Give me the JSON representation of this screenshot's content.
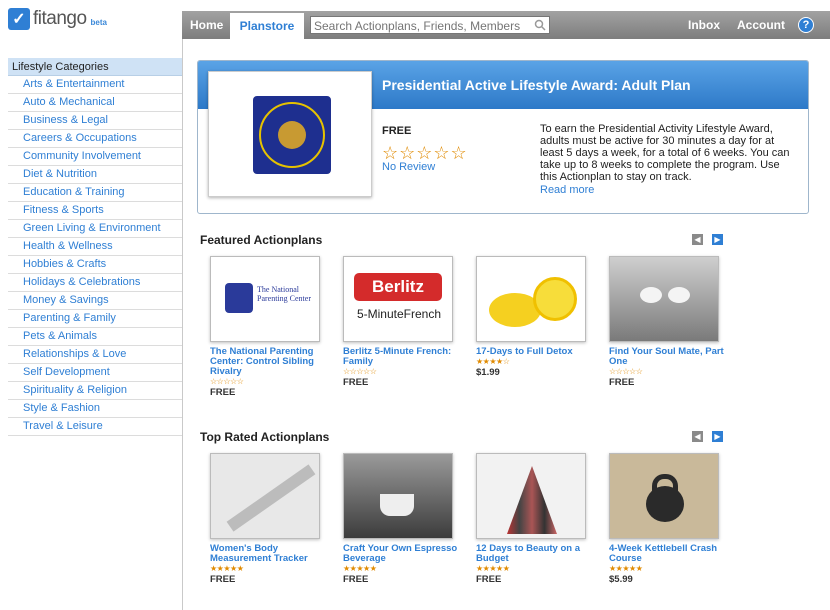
{
  "app": {
    "logo": "fitango",
    "beta": "beta"
  },
  "nav": {
    "home": "Home",
    "planstore": "Planstore",
    "search_placeholder": "Search Actionplans, Friends, Members",
    "inbox": "Inbox",
    "account": "Account",
    "help": "?"
  },
  "sidebar": {
    "header": "Lifestyle Categories",
    "items": [
      "Arts & Entertainment",
      "Auto & Mechanical",
      "Business & Legal",
      "Careers & Occupations",
      "Community Involvement",
      "Diet & Nutrition",
      "Education & Training",
      "Fitness & Sports",
      "Green Living & Environment",
      "Health & Wellness",
      "Hobbies & Crafts",
      "Holidays & Celebrations",
      "Money & Savings",
      "Parenting & Family",
      "Pets & Animals",
      "Relationships & Love",
      "Self Development",
      "Spirituality & Religion",
      "Style & Fashion",
      "Travel & Leisure"
    ]
  },
  "hero": {
    "title": "Presidential Active Lifestyle Award: Adult Plan",
    "seal_text": "PRESIDENTIAL ACTIVE LIFESTYLE AWARD",
    "price": "FREE",
    "stars": "☆☆☆☆☆",
    "review": "No Review",
    "description": "To earn the Presidential Activity Lifestyle Award, adults must be active for 30 minutes a day for at least 5 days a week, for a total of 6 weeks. You can take up to 8 weeks to complete the program. Use this Actionplan to stay on track.",
    "read_more": "Read more"
  },
  "featured": {
    "title": "Featured Actionplans",
    "items": [
      {
        "title": "The National Parenting Center: Control Sibling Rivalry",
        "stars": "☆☆☆☆☆",
        "price": "FREE",
        "logo": "The National Parenting Center"
      },
      {
        "title": "Berlitz 5-Minute French: Family",
        "stars": "☆☆☆☆☆",
        "price": "FREE",
        "logo_top": "Berlitz",
        "logo_bottom": "5-MinuteFrench"
      },
      {
        "title": "17-Days to Full Detox",
        "stars": "★★★★☆",
        "price": "$1.99"
      },
      {
        "title": "Find Your Soul Mate, Part One",
        "stars": "☆☆☆☆☆",
        "price": "FREE"
      }
    ]
  },
  "top_rated": {
    "title": "Top Rated Actionplans",
    "items": [
      {
        "title": "Women's Body Measurement Tracker",
        "stars": "★★★★★",
        "price": "FREE"
      },
      {
        "title": "Craft Your Own Espresso Beverage",
        "stars": "★★★★★",
        "price": "FREE"
      },
      {
        "title": "12 Days to Beauty on a Budget",
        "stars": "★★★★★",
        "price": "FREE"
      },
      {
        "title": "4-Week Kettlebell Crash Course",
        "stars": "★★★★★",
        "price": "$5.99"
      }
    ]
  },
  "colors": {
    "accent": "#2f7fd4",
    "star": "#e08a00",
    "nav": "#8c8c8c"
  }
}
